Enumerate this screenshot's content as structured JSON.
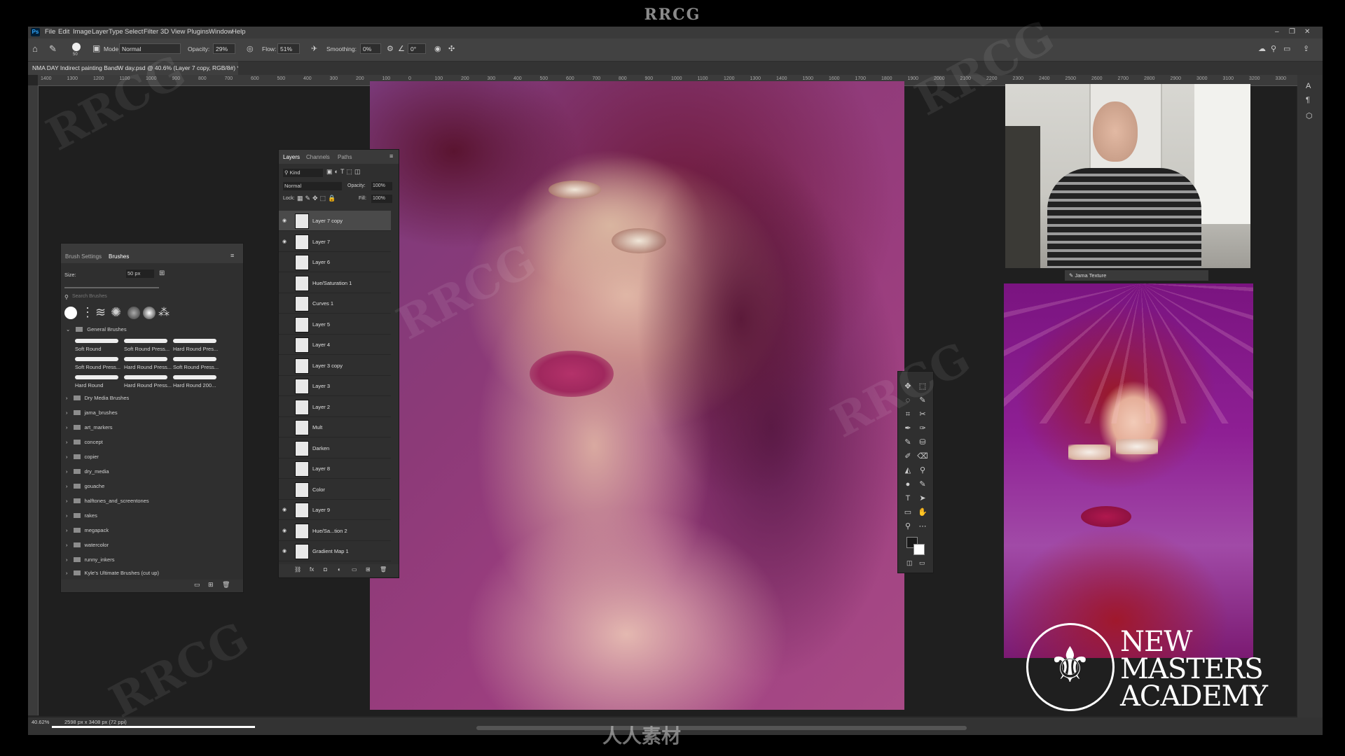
{
  "brand_watermark": "RRCG",
  "menubar": {
    "logo": "Ps",
    "items": [
      "File",
      "Edit",
      "Image",
      "Layer",
      "Type",
      "Select",
      "Filter",
      "3D",
      "View",
      "Plugins",
      "Window",
      "Help"
    ],
    "window_controls": [
      "–",
      "❐",
      "✕"
    ]
  },
  "options_bar": {
    "mode_label": "Mode:",
    "mode_value": "Normal",
    "opacity_label": "Opacity:",
    "opacity_value": "29%",
    "flow_label": "Flow:",
    "flow_value": "51%",
    "smoothing_label": "Smoothing:",
    "smoothing_value": "0%",
    "angle_value": "0°",
    "brush_size": "50"
  },
  "document_tab": "NMA DAY Indirect painting BandW day.psd @ 40.6% (Layer 7 copy, RGB/8#) *",
  "ruler_ticks": [
    "1400",
    "1300",
    "1200",
    "1100",
    "1000",
    "900",
    "800",
    "700",
    "600",
    "500",
    "400",
    "300",
    "200",
    "100",
    "0",
    "100",
    "200",
    "300",
    "400",
    "500",
    "600",
    "700",
    "800",
    "900",
    "1000",
    "1100",
    "1200",
    "1300",
    "1400",
    "1500",
    "1600",
    "1700",
    "1800",
    "1900",
    "2000",
    "2100",
    "2200",
    "2300",
    "2400",
    "2500",
    "2600",
    "2700",
    "2800",
    "2900",
    "3000",
    "3100",
    "3200",
    "3300"
  ],
  "status_bar": {
    "zoom": "40.62%",
    "doc_size": "2598 px x 3408 px (72 ppi)"
  },
  "brush_panel": {
    "tabs": [
      "Brush Settings",
      "Brushes"
    ],
    "size_label": "Size:",
    "size_value": "50 px",
    "search_placeholder": "Search Brushes",
    "group_name": "General Brushes",
    "brushes": [
      "Soft Round",
      "Soft Round Press...",
      "Hard Round Pres...",
      "Soft Round Press...",
      "Hard Round Press...",
      "Soft Round Press...",
      "Hard Round",
      "Hard Round Press...",
      "Hard Round 200..."
    ],
    "folders": [
      "Dry Media Brushes",
      "jama_brushes",
      "art_markers",
      "concept",
      "copier",
      "dry_media",
      "gouache",
      "halftones_and_screentones",
      "rakes",
      "megapack",
      "watercolor",
      "runny_inkers",
      "Kyle's Ultimate Brushes (cut up)"
    ]
  },
  "layers_panel": {
    "tabs": [
      "Layers",
      "Channels",
      "Paths"
    ],
    "filter_label": "Kind",
    "blend_mode": "Normal",
    "opacity_label": "Opacity:",
    "opacity_value": "100%",
    "lock_label": "Lock:",
    "fill_label": "Fill:",
    "fill_value": "100%",
    "layers": [
      {
        "name": "Layer 7 copy",
        "visible": true,
        "selected": true
      },
      {
        "name": "Layer 7",
        "visible": true,
        "selected": false
      },
      {
        "name": "Layer 6",
        "visible": false,
        "selected": false
      },
      {
        "name": "Hue/Saturation 1",
        "visible": false,
        "selected": false
      },
      {
        "name": "Curves 1",
        "visible": false,
        "selected": false
      },
      {
        "name": "Layer 5",
        "visible": false,
        "selected": false
      },
      {
        "name": "Layer 4",
        "visible": false,
        "selected": false
      },
      {
        "name": "Layer 3 copy",
        "visible": false,
        "selected": false
      },
      {
        "name": "Layer 3",
        "visible": false,
        "selected": false
      },
      {
        "name": "Layer 2",
        "visible": false,
        "selected": false
      },
      {
        "name": "Mult",
        "visible": false,
        "selected": false
      },
      {
        "name": "Darken",
        "visible": false,
        "selected": false
      },
      {
        "name": "Layer 8",
        "visible": false,
        "selected": false
      },
      {
        "name": "Color",
        "visible": false,
        "selected": false
      },
      {
        "name": "Layer 9",
        "visible": true,
        "selected": false
      },
      {
        "name": "Hue/Sa...tion 2",
        "visible": true,
        "selected": false
      },
      {
        "name": "Gradient Map 1",
        "visible": true,
        "selected": false
      }
    ],
    "footer_icons": [
      "link-icon",
      "fx-icon",
      "mask-icon",
      "adjustment-icon",
      "group-icon",
      "new-layer-icon",
      "trash-icon"
    ]
  },
  "toolbox": {
    "tools": [
      "✥",
      "⬚",
      "◌",
      "✎",
      "⌗",
      "✂",
      "✒",
      "✑",
      "✎",
      "⛁",
      "✐",
      "⌫",
      "◭",
      "⚲",
      "●",
      "✎",
      "T",
      "➤",
      "▭",
      "✋",
      "⚲",
      "⋯"
    ]
  },
  "webcam_label": "Jama Texture",
  "logo": {
    "line1": "NEW",
    "line2": "MASTERS",
    "line3": "ACADEMY"
  },
  "bottom_watermark": "人人素材",
  "colors": {
    "foreground": "#1a1a1a",
    "background": "#ffffff",
    "accent": "#31a8ff"
  }
}
